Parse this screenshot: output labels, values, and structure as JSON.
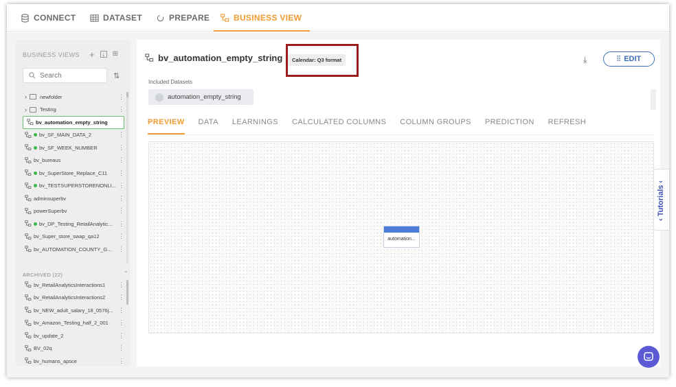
{
  "nav": {
    "tabs": [
      {
        "label": "CONNECT",
        "icon": "database-icon"
      },
      {
        "label": "DATASET",
        "icon": "table-icon"
      },
      {
        "label": "PREPARE",
        "icon": "prepare-icon"
      },
      {
        "label": "BUSINESS VIEW",
        "icon": "business-view-icon",
        "active": true
      }
    ]
  },
  "sidebar": {
    "title": "BUSINESS VIEWS",
    "search_placeholder": "Search",
    "folders": [
      "newfolder",
      "Testing"
    ],
    "items": [
      {
        "label": "bv_automation_empty_string",
        "selected": true,
        "dot": false
      },
      {
        "label": "bv_SF_MAIN_DATA_2",
        "dot": true
      },
      {
        "label": "bv_SF_WEEK_NUMBER",
        "dot": true
      },
      {
        "label": "bv_bureaus",
        "dot": false
      },
      {
        "label": "bv_SuperStore_Replace_C11",
        "dot": true
      },
      {
        "label": "bv_TESTSUPERSTORENONLI...",
        "dot": true
      },
      {
        "label": "adminsuperbv",
        "dot": false
      },
      {
        "label": "powerSuperbv",
        "dot": false
      },
      {
        "label": "bv_DP_Testing_RetailAnalytic...",
        "dot": true
      },
      {
        "label": "bv_Super_store_swap_qa12",
        "dot": false
      },
      {
        "label": "bv_AUTOMATION_COUNTY_G...",
        "dot": false
      }
    ],
    "archived_label": "ARCHIVED",
    "archived_count": "(22)",
    "archived_items": [
      "bv_RetailAnalyticsInteractions1",
      "bv_RetailAnalyticsInteractions2",
      "bv_NEW_adult_salary_18_0576j...",
      "bv_Amazon_Testing_half_2_001",
      "bv_update_2",
      "BV_02q",
      "bv_humans_apsce"
    ]
  },
  "main": {
    "title": "bv_automation_empty_string",
    "calendar_badge": "Calendar: Q3 format",
    "edit_label": "EDIT",
    "included_label": "Included Datasets",
    "dataset_chip": "automation_empty_string",
    "tabs": [
      "PREVIEW",
      "DATA",
      "LEARNINGS",
      "CALCULATED COLUMNS",
      "COLUMN GROUPS",
      "PREDICTION",
      "REFRESH"
    ],
    "active_tab": "PREVIEW",
    "node_label": "automation..."
  },
  "tutorials_label": "Tutorials",
  "colors": {
    "accent": "#f29b30",
    "primary": "#3d6fb4",
    "status_green": "#3cb84a",
    "highlight": "#9b1c1c"
  }
}
